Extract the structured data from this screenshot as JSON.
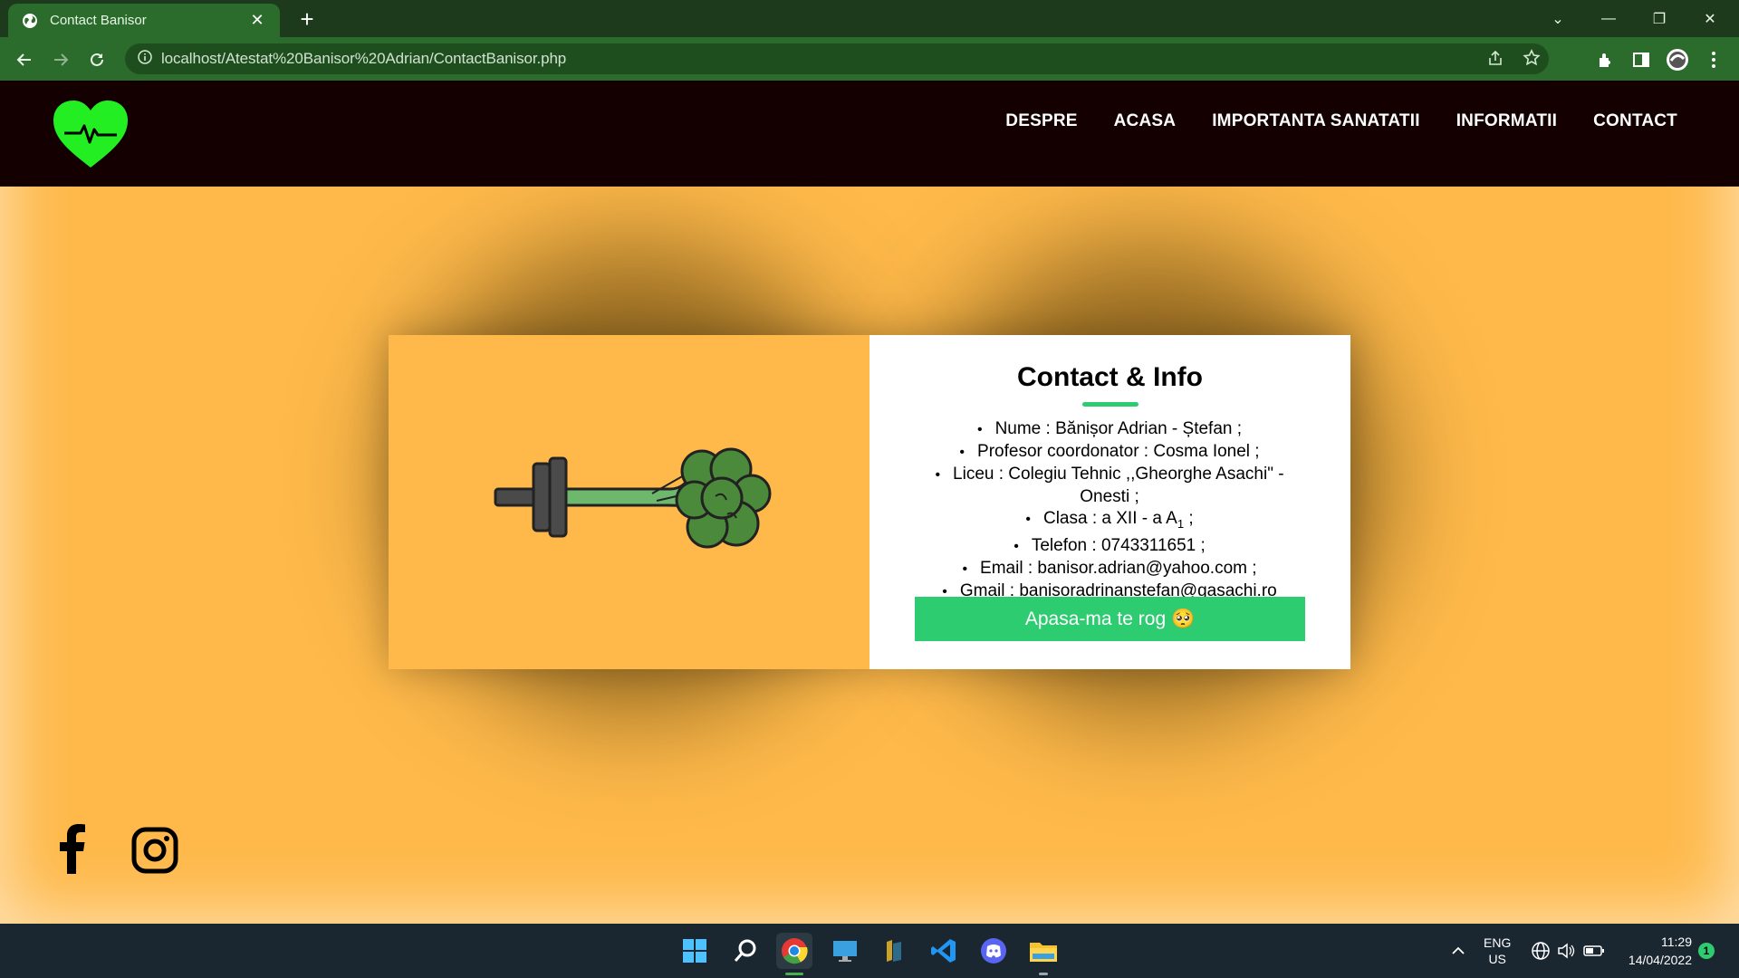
{
  "browser": {
    "tab_title": "Contact Banisor",
    "url": "localhost/Atestat%20Banisor%20Adrian/ContactBanisor.php"
  },
  "site": {
    "nav": [
      "DESPRE",
      "ACASA",
      "IMPORTANTA SANATATII",
      "INFORMATII",
      "CONTACT"
    ],
    "card": {
      "title": "Contact & Info",
      "items": [
        "Nume : Bănișor Adrian - Ștefan ;",
        "Profesor coordonator : Cosma Ionel ;",
        "Liceu : Colegiu Tehnic ,,Gheorghe Asachi\" - Onesti ;",
        "Clasa : a XII - a A",
        "Telefon : 0743311651 ;",
        "Email : banisor.adrian@yahoo.com ;",
        "Gmail : banisoradrinanstefan@gasachi.ro"
      ],
      "clasa_sub": "1",
      "clasa_suffix": " ;",
      "button_label": "Apasa-ma te rog 🥺"
    }
  },
  "taskbar": {
    "lang_top": "ENG",
    "lang_bottom": "US",
    "time": "11:29",
    "date": "14/04/2022",
    "notif_count": "1"
  },
  "colors": {
    "page_bg": "#feb94a",
    "navbar_bg": "#140000",
    "accent_green": "#2ecc71",
    "logo_green": "#22ee22"
  }
}
